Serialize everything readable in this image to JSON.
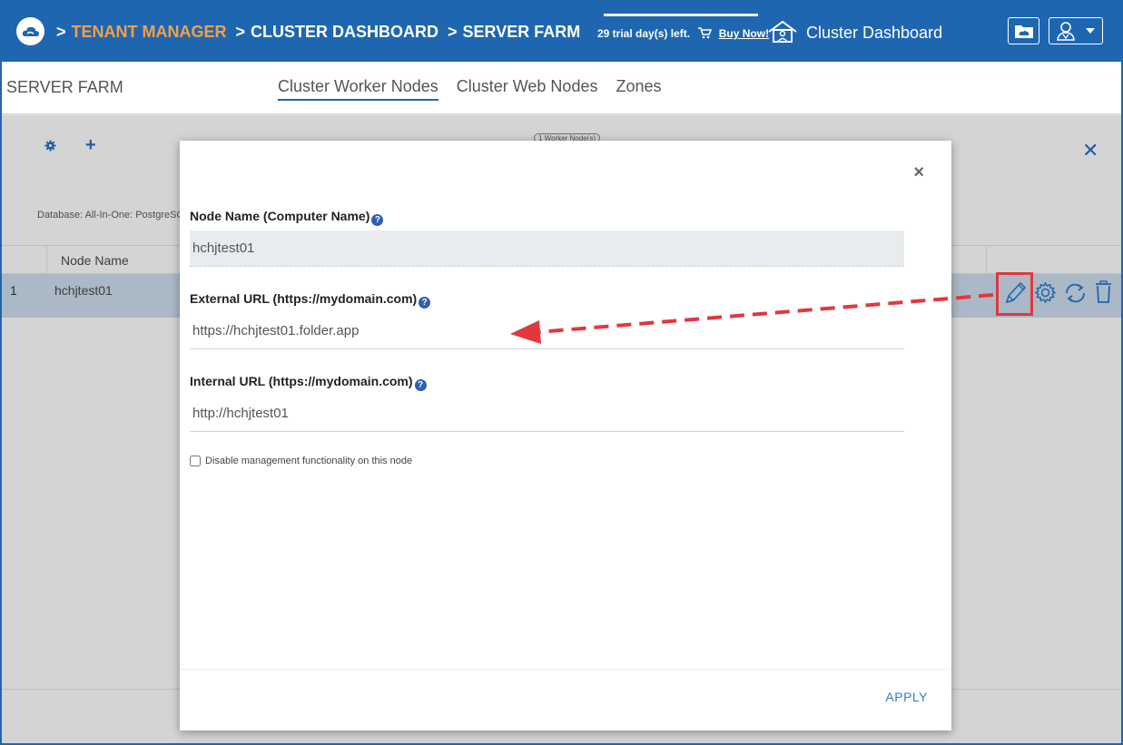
{
  "header": {
    "breadcrumb_sep": ">",
    "crumbs": [
      "TENANT MANAGER",
      "CLUSTER DASHBOARD",
      "SERVER FARM"
    ],
    "trial_text": "29 trial day(s) left.",
    "buy_label": "Buy Now!",
    "dashboard_title": "Cluster Dashboard",
    "accent_color": "#1f66b0",
    "crumb_highlight_color": "#f0a04b"
  },
  "subnav": {
    "title": "SERVER FARM",
    "tabs": [
      {
        "label": "Cluster Worker Nodes",
        "active": true
      },
      {
        "label": "Cluster Web Nodes",
        "active": false
      },
      {
        "label": "Zones",
        "active": false
      }
    ]
  },
  "background": {
    "pill": "1 Worker Node(s)",
    "database": "Database: All-In-One: PostgreSQL",
    "table": {
      "columns": [
        "Node Name"
      ],
      "rows": [
        {
          "index": "1",
          "name": "hchjtest01"
        }
      ]
    }
  },
  "modal": {
    "close_label": "×",
    "node_name_label": "Node Name (Computer Name)",
    "node_name_value": "hchjtest01",
    "external_url_label": "External URL (https://mydomain.com)",
    "external_url_value": "https://hchjtest01.folder.app",
    "internal_url_label": "Internal URL (https://mydomain.com)",
    "internal_url_value": "http://hchjtest01",
    "checkbox_label": "Disable management functionality on this node",
    "checkbox_checked": false,
    "apply_label": "APPLY",
    "help_glyph": "?"
  }
}
